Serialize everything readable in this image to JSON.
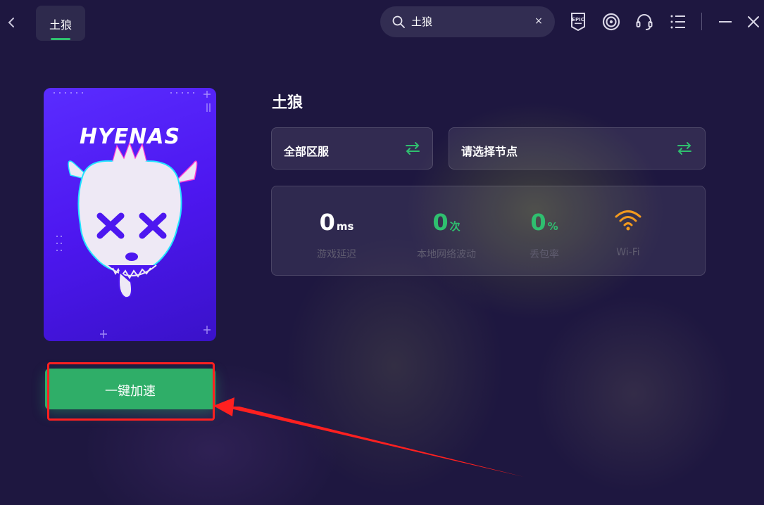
{
  "header": {
    "tab_label": "土狼",
    "search": {
      "value": "土狼",
      "clear_label": "×"
    }
  },
  "game": {
    "title": "土狼",
    "cover_title": "HYENAS",
    "region_label": "全部区服",
    "node_label": "请选择节点",
    "accelerate_label": "一键加速"
  },
  "stats": [
    {
      "value": "0",
      "unit": "ms",
      "caption": "游戏延迟",
      "color": "#ffffff"
    },
    {
      "value": "0",
      "unit": "次",
      "caption": "本地网络波动",
      "color": "#2fbf6f"
    },
    {
      "value": "0",
      "unit": "%",
      "caption": "丢包率",
      "color": "#2fbf6f"
    },
    {
      "caption": "Wi-Fi",
      "icon": "wifi-icon",
      "color": "#f39a1e"
    }
  ],
  "colors": {
    "accent": "#2fbf6f",
    "background": "#1e1740",
    "button": "#2fae68",
    "highlight": "#ff2020",
    "wifi": "#f39a1e"
  }
}
